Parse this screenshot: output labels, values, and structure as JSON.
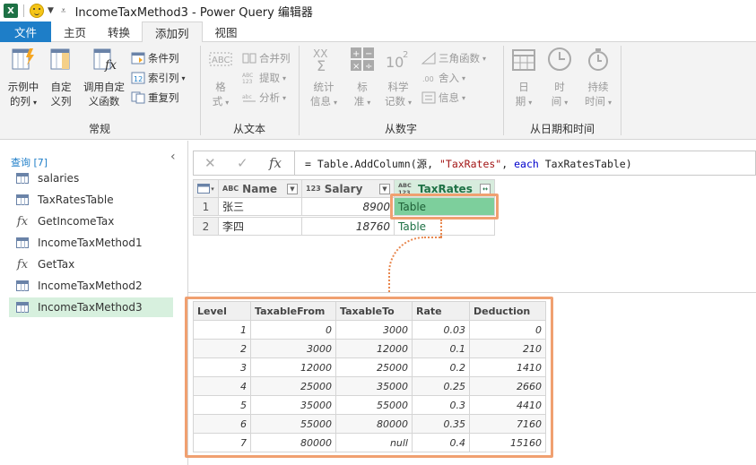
{
  "app": {
    "title": "IncomeTaxMethod3 - Power Query 编辑器",
    "excel_letter": "X"
  },
  "tabs": [
    {
      "label": "文件"
    },
    {
      "label": "主页"
    },
    {
      "label": "转换"
    },
    {
      "label": "添加列"
    },
    {
      "label": "视图"
    }
  ],
  "ribbon": {
    "general": {
      "label": "常规",
      "example_col": [
        "示例中",
        "的列"
      ],
      "custom_col": [
        "自定",
        "义列"
      ],
      "invoke_func": [
        "调用自定",
        "义函数"
      ],
      "conditional": "条件列",
      "index": "索引列",
      "duplicate": "重复列"
    },
    "text": {
      "label": "从文本",
      "format": [
        "格",
        "式"
      ],
      "merge": "合并列",
      "extract": "提取",
      "parse": "分析"
    },
    "number": {
      "label": "从数字",
      "stats": [
        "统计",
        "信息"
      ],
      "standard": [
        "标",
        "准"
      ],
      "scientific": [
        "科学",
        "记数"
      ],
      "trig": "三角函数",
      "round": "舍入",
      "info": "信息"
    },
    "datetime": {
      "label": "从日期和时间",
      "date": [
        "日",
        "期"
      ],
      "time": [
        "时",
        "间"
      ],
      "duration": [
        "持续",
        "时间"
      ]
    }
  },
  "queries": {
    "header": "查询 [7]",
    "items": [
      {
        "name": "salaries",
        "type": "table"
      },
      {
        "name": "TaxRatesTable",
        "type": "table"
      },
      {
        "name": "GetIncomeTax",
        "type": "function"
      },
      {
        "name": "IncomeTaxMethod1",
        "type": "table"
      },
      {
        "name": "GetTax",
        "type": "function"
      },
      {
        "name": "IncomeTaxMethod2",
        "type": "table"
      },
      {
        "name": "IncomeTaxMethod3",
        "type": "table",
        "selected": true
      }
    ]
  },
  "formula": {
    "fx": "fx",
    "prefix": "= Table.AddColumn(源, ",
    "string": "\"TaxRates\"",
    "mid": ", ",
    "keyword": "each",
    "suffix": " TaxRatesTable)"
  },
  "grid": {
    "columns": [
      {
        "name": "Name",
        "type": "ABC"
      },
      {
        "name": "Salary",
        "type": "123"
      },
      {
        "name": "TaxRates",
        "type": "ABC 123"
      }
    ],
    "rows": [
      {
        "num": "1",
        "name": "张三",
        "salary": "8900",
        "taxrates": "Table"
      },
      {
        "num": "2",
        "name": "李四",
        "salary": "18760",
        "taxrates": "Table"
      }
    ]
  },
  "preview": {
    "columns": [
      "Level",
      "TaxableFrom",
      "TaxableTo",
      "Rate",
      "Deduction"
    ],
    "rows": [
      [
        "1",
        "0",
        "3000",
        "0.03",
        "0"
      ],
      [
        "2",
        "3000",
        "12000",
        "0.1",
        "210"
      ],
      [
        "3",
        "12000",
        "25000",
        "0.2",
        "1410"
      ],
      [
        "4",
        "25000",
        "35000",
        "0.25",
        "2660"
      ],
      [
        "5",
        "35000",
        "55000",
        "0.3",
        "4410"
      ],
      [
        "6",
        "55000",
        "80000",
        "0.35",
        "7160"
      ],
      [
        "7",
        "80000",
        "null",
        "0.4",
        "15160"
      ]
    ]
  }
}
